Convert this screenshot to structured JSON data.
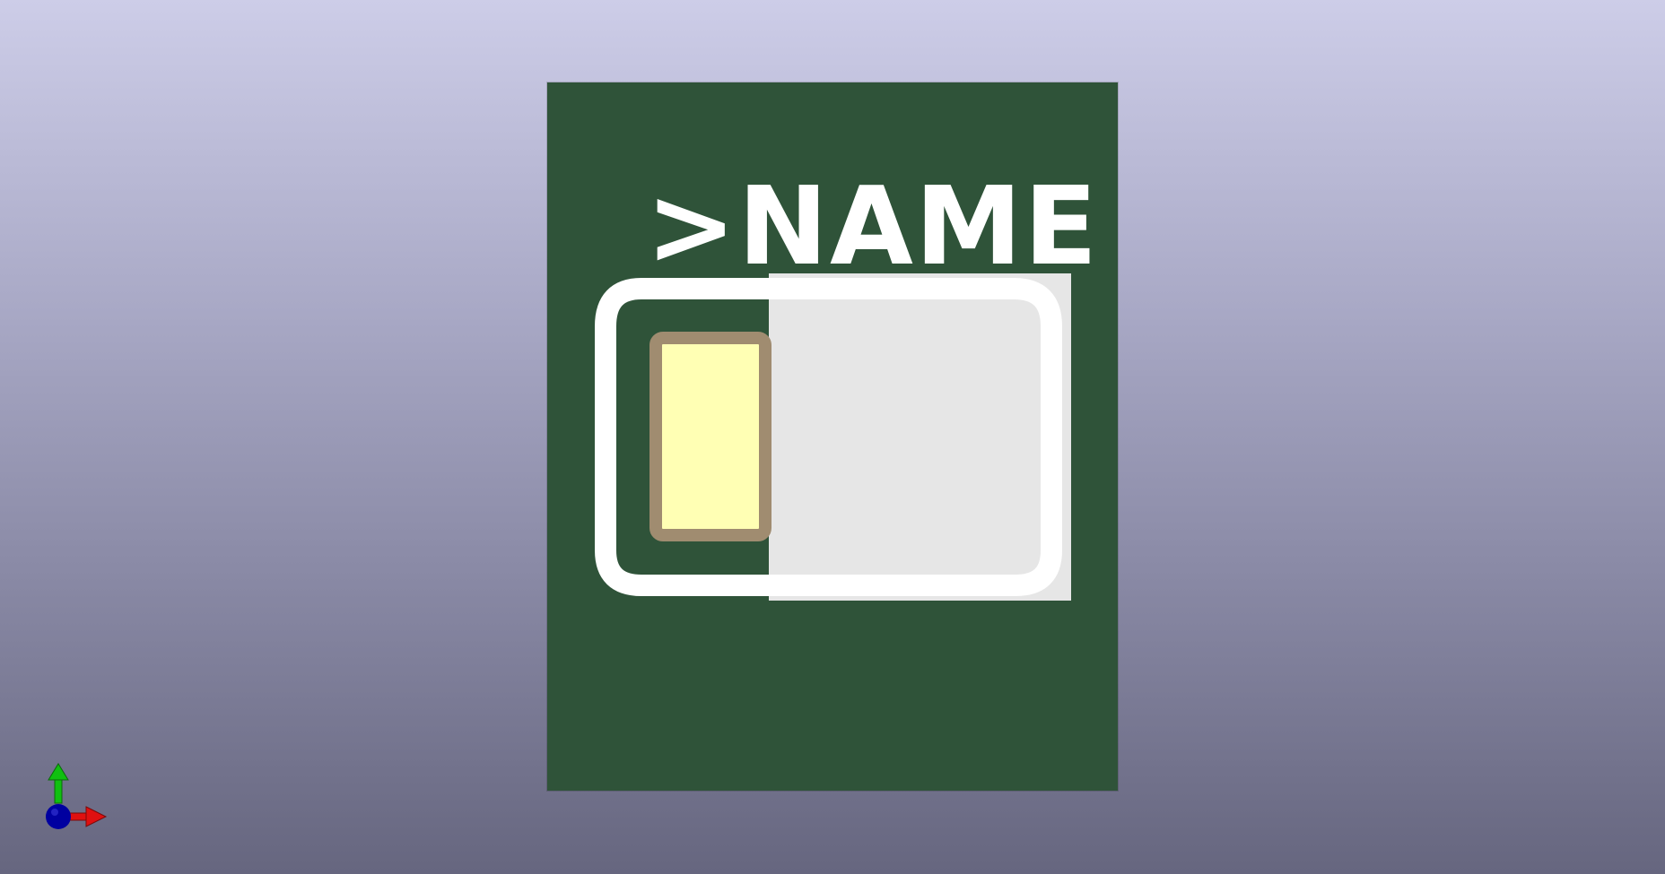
{
  "viewer": {
    "background_top": "#cdcde8",
    "background_bottom": "#66667f"
  },
  "board": {
    "color": "#2f5339",
    "silkscreen_color": "#ffffff",
    "reference_label": ">NAME"
  },
  "pad": {
    "fill_color": "#ffffb4",
    "outline_color": "#a08c70"
  },
  "body_component": {
    "color": "#e6e6e6"
  },
  "axes": {
    "x_color": "#e01010",
    "y_color": "#10c010",
    "z_color": "#0000a0",
    "x_icon": "x-axis-arrow-icon",
    "y_icon": "y-axis-arrow-icon",
    "z_icon": "z-axis-origin-icon"
  }
}
